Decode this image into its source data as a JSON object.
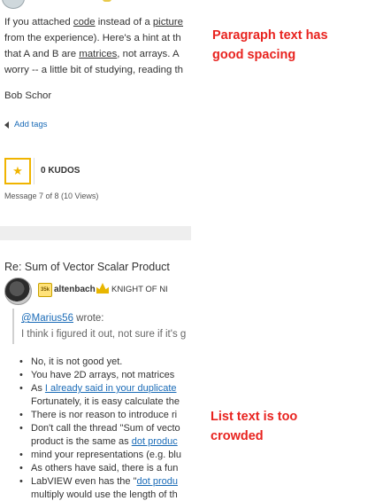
{
  "post": {
    "paragraph_lines": [
      {
        "text": "If you attached ",
        "link": "code",
        "after": " instead of a ",
        "link2": "picture",
        "after2": ""
      },
      {
        "text": "from the experience).  Here's a hint at th"
      },
      {
        "text": "that A and B are ",
        "link": "matrices",
        "after": ", not arrays.  A"
      },
      {
        "text": "worry -- a little bit of studying, reading th"
      }
    ],
    "signature": "Bob Schor",
    "add_tags": "Add tags",
    "kudos_count": "0 KUDOS",
    "message_info": "Message 7 of 8 (10 Views)"
  },
  "reply": {
    "title": "Re: Sum of Vector Scalar Product",
    "badge": "35k",
    "username": "altenbach",
    "rank": "KNIGHT OF NI",
    "quote_author": "@Marius56",
    "quote_wrote": " wrote:",
    "quote_text": "I think i figured it out, not sure if it's g",
    "list_items": [
      {
        "text": "No, it is not good yet."
      },
      {
        "text": "You have 2D arrays, not matrices"
      },
      {
        "text": "As ",
        "link": "I already said in your duplicate",
        "after": ""
      },
      {
        "text": "Fortunately, it is easy calculate the",
        "continuation": true
      },
      {
        "text": "There is nor reason to introduce ri"
      },
      {
        "text": "Don't call the thread \"Sum of vecto"
      },
      {
        "text": "product is the same as ",
        "link": "dot produc",
        "after": "",
        "continuation": true
      },
      {
        "text": "mind your representations (e.g. blu"
      },
      {
        "text": "As others have said, there is a fun"
      },
      {
        "text": "LabVIEW even has the \"",
        "link": "dot produ",
        "after": ""
      },
      {
        "text": "multiply would use the length of th",
        "continuation": true
      }
    ]
  },
  "annotations": {
    "paragraph_note": [
      "Paragraph text has",
      "good spacing"
    ],
    "list_note": [
      "List text is too",
      "crowded"
    ],
    "color": "#e8231f"
  },
  "icons": [
    "star-icon",
    "tag-icon",
    "rank-crown-icon",
    "avatar"
  ]
}
